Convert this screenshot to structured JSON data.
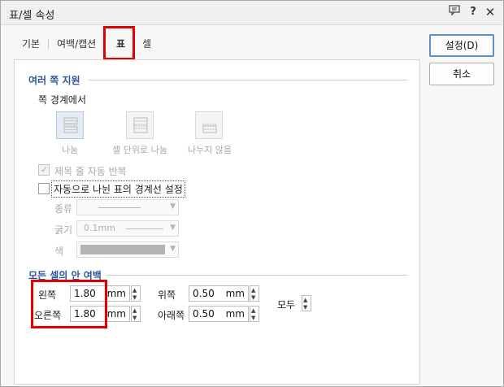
{
  "window": {
    "title": "표/셀 속성",
    "help_icon": "help-icon",
    "chat_icon": "comment-icon",
    "close_icon": "close-icon"
  },
  "tabs": [
    {
      "label": "기본"
    },
    {
      "label": "여백/캡션"
    },
    {
      "label": "표"
    },
    {
      "label": "셀"
    }
  ],
  "buttons": {
    "ok": "설정(D)",
    "cancel": "취소"
  },
  "page_split": {
    "section_title": "여러 쪽 지원",
    "boundary_label": "쪽 경계에서",
    "options": [
      {
        "label": "나눔",
        "icon": "split-table-icon"
      },
      {
        "label": "셀 단위로 나눔",
        "icon": "split-by-cell-icon"
      },
      {
        "label": "나누지 않음",
        "icon": "no-split-icon"
      }
    ],
    "repeat_header": "제목 줄 자동 반복",
    "auto_border": "자동으로 나뉜 표의 경계선 설정",
    "type_label": "종류",
    "thickness_label": "굵기",
    "thickness_value": "0.1mm",
    "color_label": "색"
  },
  "margins": {
    "section_title": "모든 셀의 안 여백",
    "left_label": "왼쪽",
    "left_value": "1.80",
    "right_label": "오른쪽",
    "right_value": "1.80",
    "top_label": "위쪽",
    "top_value": "0.50",
    "bottom_label": "아래쪽",
    "bottom_value": "0.50",
    "unit": "mm",
    "all_label": "모두"
  },
  "colors": {
    "highlight": "#e00000",
    "section_title": "#2b579a",
    "primary_border": "#5b8ecb"
  }
}
